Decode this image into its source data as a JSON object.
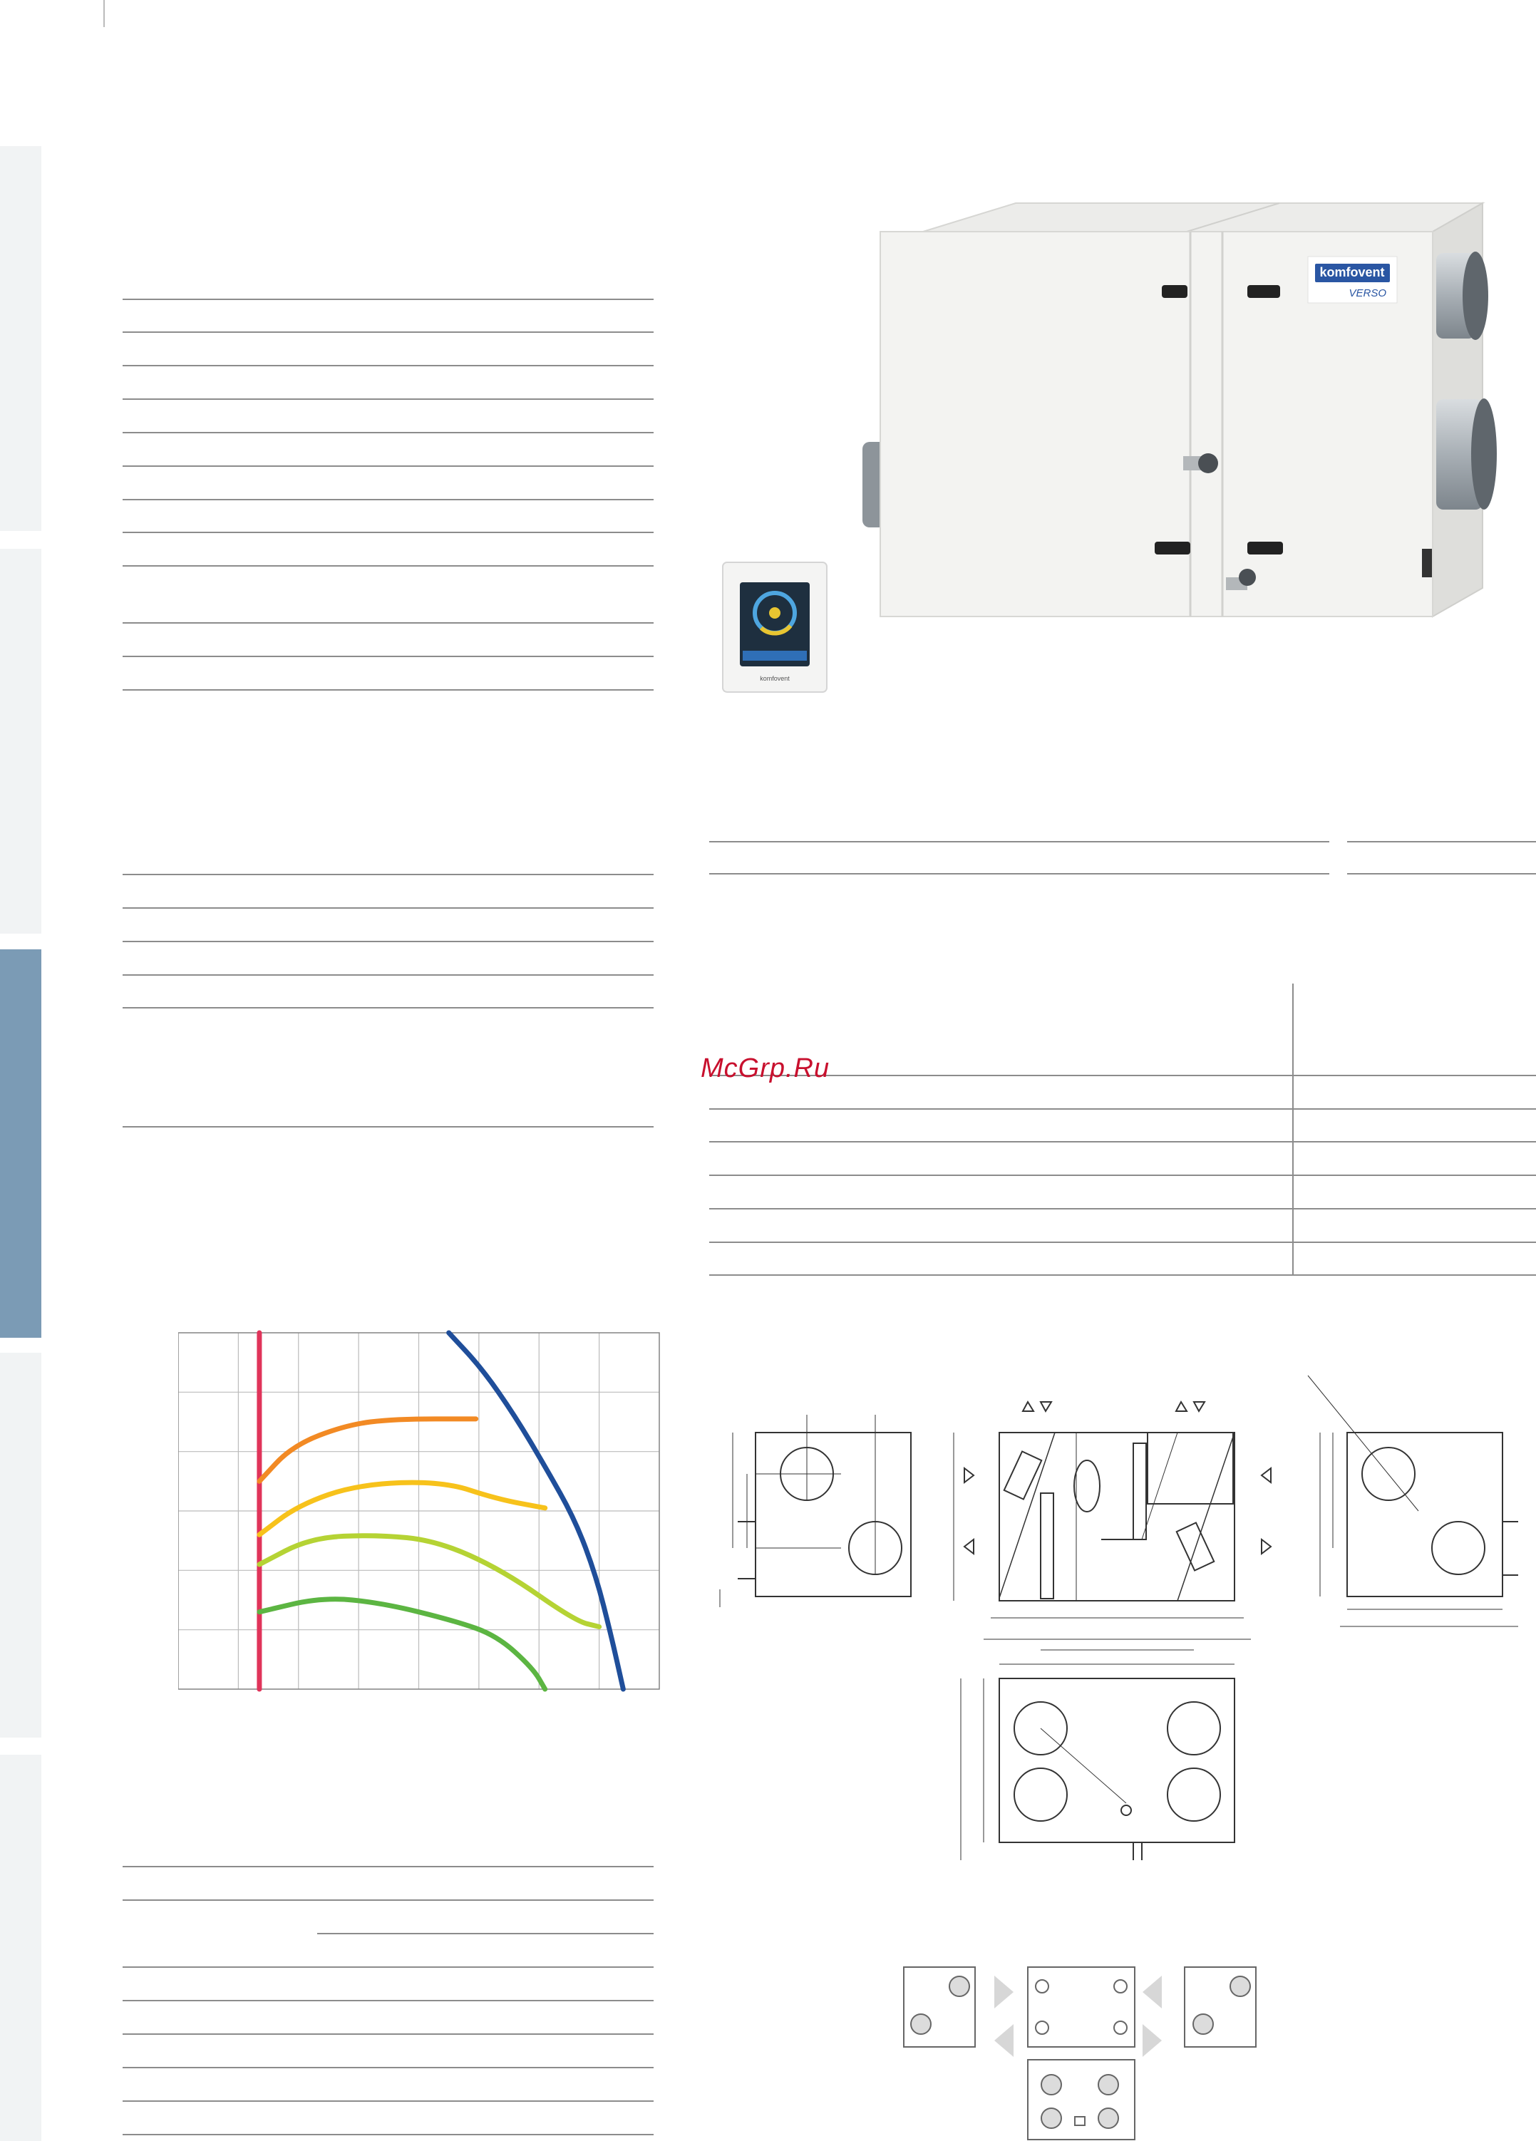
{
  "watermark": "McGrp.Ru",
  "product": {
    "brand": "komfovent",
    "model": "VERSO"
  },
  "colors": {
    "side_tab": "#f1f3f4",
    "side_tab_active": "#7b9bb5",
    "curve_red": "#e0345a",
    "curve_orange": "#f28a24",
    "curve_yellow": "#f7c21b",
    "curve_lime": "#b5d334",
    "curve_green": "#5cb542",
    "curve_blue": "#1f4e9a"
  },
  "chart_data": {
    "type": "line",
    "title": "",
    "xlabel": "",
    "ylabel": "",
    "xlim": [
      0,
      8
    ],
    "ylim": [
      0,
      6
    ],
    "x_gridlines": 8,
    "y_gridlines": 6,
    "grid": true,
    "series": [
      {
        "color": "#e0345a",
        "points": [
          [
            1.35,
            6.0
          ],
          [
            1.35,
            0.0
          ]
        ]
      },
      {
        "color": "#f28a24",
        "points": [
          [
            1.35,
            3.5
          ],
          [
            1.9,
            4.1
          ],
          [
            2.8,
            4.45
          ],
          [
            3.6,
            4.55
          ],
          [
            4.95,
            4.55
          ]
        ]
      },
      {
        "color": "#f7c21b",
        "points": [
          [
            1.35,
            2.6
          ],
          [
            2.0,
            3.1
          ],
          [
            3.0,
            3.45
          ],
          [
            4.4,
            3.5
          ],
          [
            5.3,
            3.2
          ],
          [
            6.1,
            3.05
          ]
        ]
      },
      {
        "color": "#b5d334",
        "points": [
          [
            1.35,
            2.1
          ],
          [
            2.2,
            2.55
          ],
          [
            3.3,
            2.6
          ],
          [
            4.3,
            2.5
          ],
          [
            5.4,
            2.0
          ],
          [
            6.6,
            1.15
          ],
          [
            7.0,
            1.05
          ]
        ]
      },
      {
        "color": "#5cb542",
        "points": [
          [
            1.35,
            1.3
          ],
          [
            2.4,
            1.55
          ],
          [
            3.4,
            1.45
          ],
          [
            4.6,
            1.15
          ],
          [
            5.3,
            0.9
          ],
          [
            5.9,
            0.35
          ],
          [
            6.1,
            0.0
          ]
        ]
      },
      {
        "color": "#1f4e9a",
        "points": [
          [
            4.5,
            6.0
          ],
          [
            5.05,
            5.4
          ],
          [
            5.6,
            4.6
          ],
          [
            6.1,
            3.75
          ],
          [
            6.6,
            2.85
          ],
          [
            6.95,
            1.9
          ],
          [
            7.2,
            0.9
          ],
          [
            7.4,
            0.0
          ]
        ]
      }
    ]
  }
}
